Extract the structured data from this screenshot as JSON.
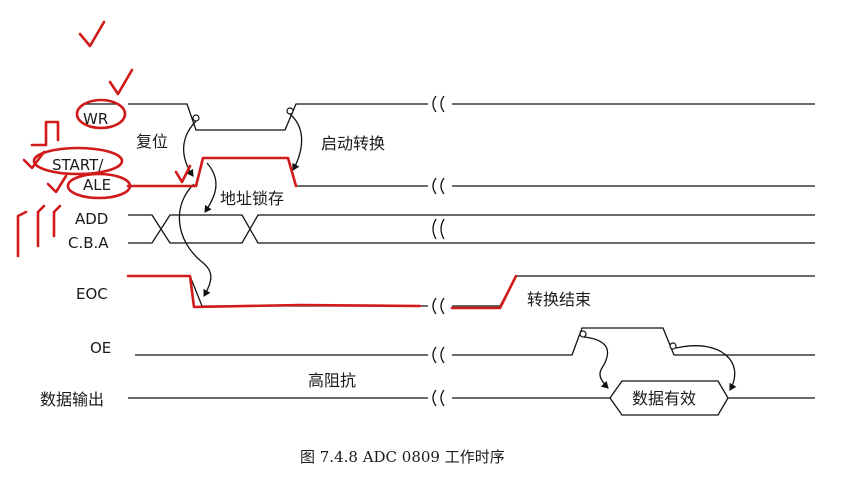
{
  "signals": {
    "wr": "WR",
    "start": "START/",
    "ale": "ALE",
    "add": "ADD",
    "cba": "C.B.A",
    "eoc": "EOC",
    "oe": "OE",
    "data_out": "数据输出"
  },
  "annotations": {
    "reset": "复位",
    "start_conversion": "启动转换",
    "address_latch": "地址锁存",
    "conversion_end": "转换结束",
    "high_impedance": "高阻抗",
    "data_valid": "数据有效"
  },
  "caption": "图 7.4.8   ADC 0809 工作时序",
  "colors": {
    "ink": "#111111",
    "handwriting": "#d11a1a",
    "background": "#ffffff"
  }
}
